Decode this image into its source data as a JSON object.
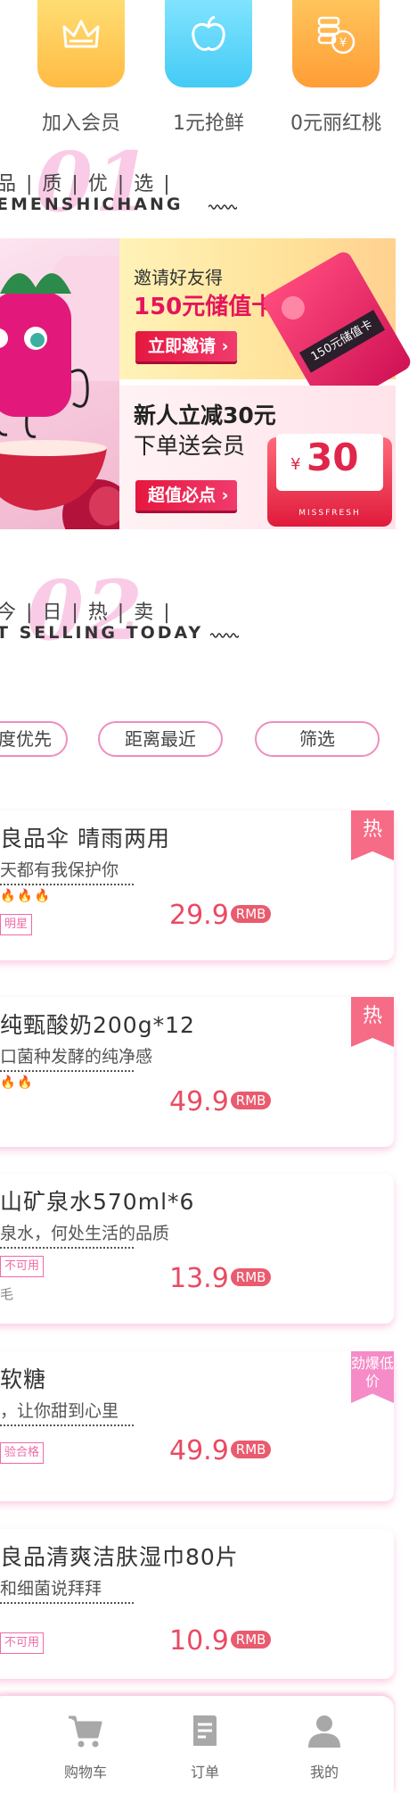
{
  "quick_actions": [
    {
      "label": "加入会员",
      "icon": "crown-icon",
      "color_from": "#ffd86b",
      "color_to": "#ffb53d"
    },
    {
      "label": "1元抢鲜",
      "icon": "apple-icon",
      "color_from": "#7ce1ff",
      "color_to": "#3fc9f5"
    },
    {
      "label": "0元丽红桃",
      "icon": "coins-icon",
      "color_from": "#ffc35a",
      "color_to": "#ff9c34"
    }
  ],
  "section1": {
    "number": "01",
    "cn": "品 | 质 | 优 | 选 |",
    "en": "EMENSHICHANG"
  },
  "promo": {
    "invite": {
      "line1": "邀请好友得",
      "line2": "150元储值卡",
      "button": "立即邀请",
      "card_text": "150元储值卡"
    },
    "newcomer": {
      "line1": "新人立减30元",
      "line2": "下单送会员",
      "button": "超值必点",
      "amount": "30",
      "currency": "¥",
      "brand": "MISSFRESH"
    }
  },
  "section2": {
    "number": "02",
    "cn": "今 | 日 | 热 | 卖 |",
    "en": "T SELLING TODAY"
  },
  "filters": [
    "度优先",
    "距离最近",
    "筛选"
  ],
  "products": [
    {
      "title": "良品伞 晴雨两用",
      "subtitle": "天都有我保护你",
      "tag": "明星",
      "flames": "🔥🔥🔥",
      "extra": "",
      "price": "29.9",
      "unit": "RMB",
      "badge": "热",
      "badge_color": "#f66b86"
    },
    {
      "title": "纯甄酸奶200g*12",
      "subtitle": "口菌种发酵的纯净感",
      "tag": "",
      "flames": "🔥🔥",
      "extra": "",
      "price": "49.9",
      "unit": "RMB",
      "badge": "热",
      "badge_color": "#f66b86"
    },
    {
      "title": "山矿泉水570ml*6",
      "subtitle": "泉水，何处生活的品质",
      "tag": "不可用",
      "flames": "",
      "extra": "毛",
      "price": "13.9",
      "unit": "RMB",
      "badge": "",
      "badge_color": ""
    },
    {
      "title": "软糖",
      "subtitle": "，让你甜到心里",
      "tag": "验合格",
      "flames": "",
      "extra": "",
      "price": "49.9",
      "unit": "RMB",
      "badge": "劲爆低价",
      "badge_color": "#f58bc7"
    },
    {
      "title": "良品清爽洁肤湿巾80片",
      "subtitle": "和细菌说拜拜",
      "tag": "不可用",
      "flames": "",
      "extra": "",
      "price": "10.9",
      "unit": "RMB",
      "badge": "",
      "badge_color": ""
    }
  ],
  "tabbar": [
    {
      "label": "购物车",
      "icon": "cart-icon"
    },
    {
      "label": "订单",
      "icon": "order-icon"
    },
    {
      "label": "我的",
      "icon": "profile-icon"
    }
  ],
  "colors": {
    "accent_pink": "#f08dc0",
    "price_red": "#ea4a63"
  }
}
